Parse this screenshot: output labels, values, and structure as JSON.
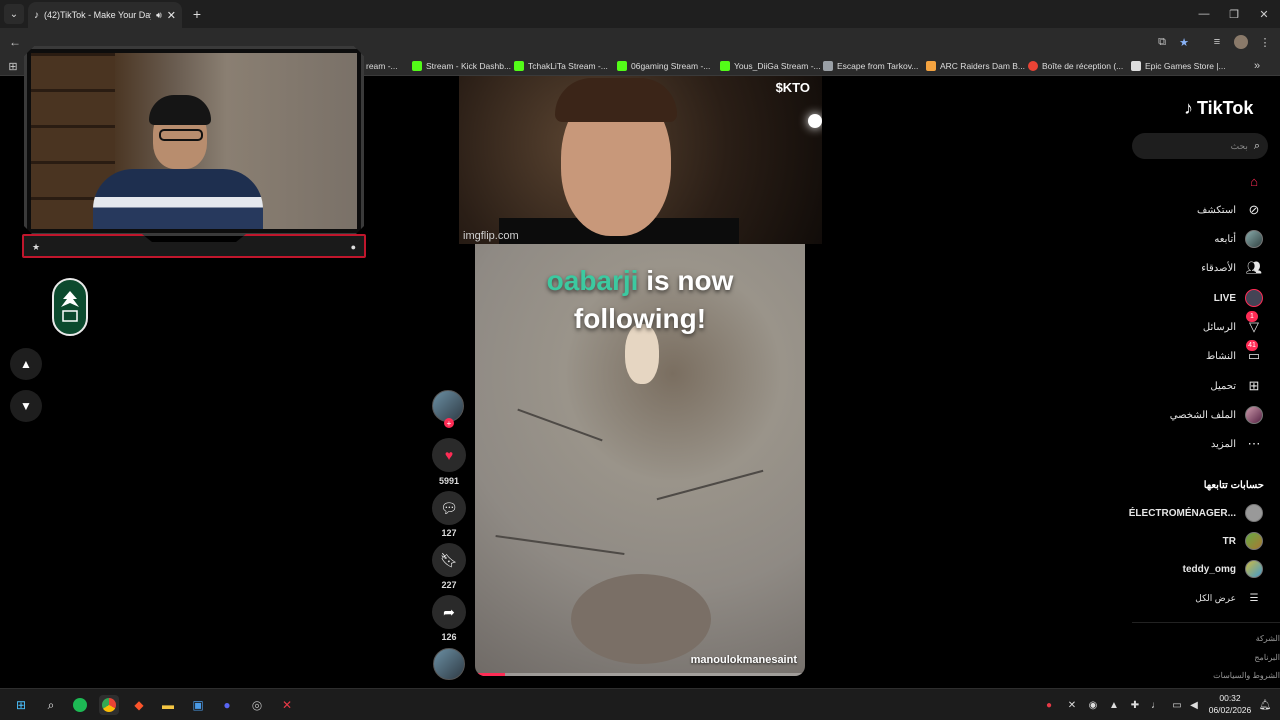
{
  "browser": {
    "tab_title": "(42)TikTok - Make Your Day",
    "tab_favicon_icon": "tiktok-icon",
    "tab_audio_icon": "speaker-icon",
    "bookmarks": [
      {
        "label": "Stream - Kick Dashb...",
        "color": "#53fc18"
      },
      {
        "label": "TchakLiTa Stream -...",
        "color": "#53fc18"
      },
      {
        "label": "06gaming Stream -...",
        "color": "#53fc18"
      },
      {
        "label": "Yous_DiiGa Stream -...",
        "color": "#53fc18"
      },
      {
        "label": "Escape from Tarkov...",
        "color": "#9aa0a6"
      },
      {
        "label": "ARC Raiders Dam B...",
        "color": "#f4a340"
      },
      {
        "label": "Boîte de réception (...",
        "color": "#ea4335"
      },
      {
        "label": "Epic Games Store |...",
        "color": "#dddddd"
      }
    ],
    "bookmarks_partial": "ream -..."
  },
  "gif": {
    "watermark": "imgflip.com",
    "tag": "$KTO"
  },
  "video": {
    "follow_user": "oabarji",
    "follow_text_1": "is now",
    "follow_text_2": "following!",
    "author": "manoulokmanesaint",
    "progress": 0.09
  },
  "actions": {
    "likes": "5991",
    "comments": "127",
    "saves": "227",
    "shares": "126"
  },
  "tiktok": {
    "logo": "TikTok",
    "search_placeholder": "بحث",
    "nav": [
      {
        "label": "",
        "icon": "home-icon",
        "active": true
      },
      {
        "label": "استكشف",
        "icon": "compass-icon"
      },
      {
        "label": "أتابعه",
        "icon": "avatar-icon"
      },
      {
        "label": "الأصدقاء",
        "icon": "friends-icon"
      },
      {
        "label": "LIVE",
        "icon": "live-icon"
      },
      {
        "label": "الرسائل",
        "icon": "send-icon",
        "badge": "1"
      },
      {
        "label": "النشاط",
        "icon": "activity-icon",
        "badge": "41"
      },
      {
        "label": "تحميل",
        "icon": "upload-icon"
      },
      {
        "label": "الملف الشخصي",
        "icon": "profile-icon"
      },
      {
        "label": "المزيد",
        "icon": "more-icon"
      }
    ],
    "following_title": "حسابات تتابعها",
    "following": [
      "ÉLECTROMÉNAGER...",
      "TR",
      "teddy_omg"
    ],
    "see_all": "عرض الكل",
    "footer": [
      "الشركة",
      "البرنامج",
      "الشروط والسياسات"
    ]
  },
  "taskbar": {
    "time": "00:32",
    "date": "06/02/2026"
  },
  "colors": {
    "accent": "#fe2c55",
    "follow_user": "#3cc9a0",
    "cam_border": "#c0162c"
  }
}
